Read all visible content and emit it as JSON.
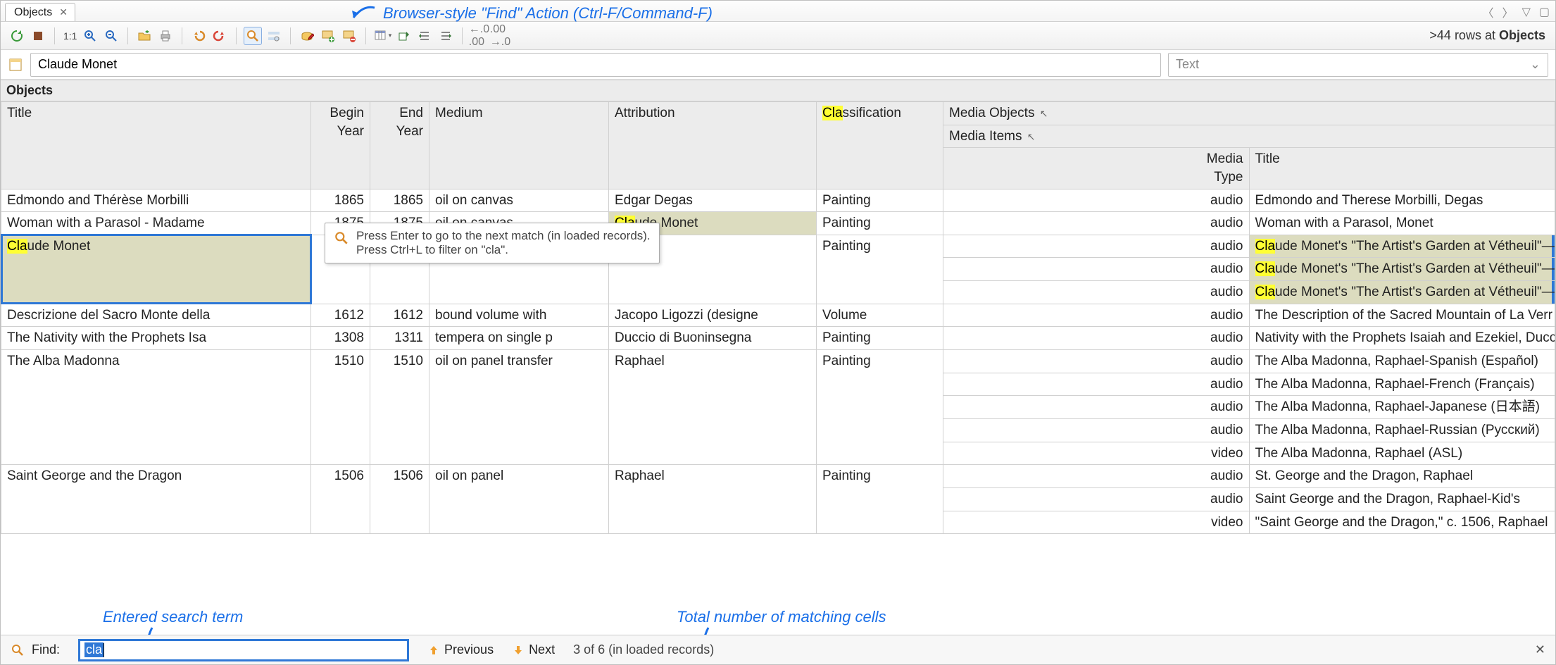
{
  "tab": {
    "title": "Objects"
  },
  "annotations": {
    "find_action": "Browser-style \"Find\" Action (Ctrl-F/Command-F)",
    "entered_term": "Entered search term",
    "total_match": "Total number of matching cells"
  },
  "toolbar": {
    "ratio": "1:1",
    "rowcount_prefix": ">44 rows at ",
    "rowcount_target": "Objects"
  },
  "filter": {
    "value": "Claude Monet",
    "type_label": "Text"
  },
  "section": {
    "title": "Objects"
  },
  "headers": {
    "title": "Title",
    "begin": "Begin Year",
    "end": "End Year",
    "medium": "Medium",
    "attribution": "Attribution",
    "classification": "Classification",
    "media_objects": "Media Objects",
    "media_items": "Media Items",
    "media_type": "Media Type",
    "mtitle": "Title"
  },
  "rows": [
    {
      "title": "Edmondo and Thérèse Morbilli",
      "begin": "1865",
      "end": "1865",
      "medium": "oil on canvas",
      "attr": "Edgar Degas",
      "class": "Painting",
      "media": [
        {
          "type": "audio",
          "title": "Edmondo and Therese Morbilli, Degas"
        }
      ]
    },
    {
      "title": "Woman with a Parasol - Madame",
      "begin": "1875",
      "end": "1875",
      "medium": "oil on canvas",
      "attr": "Claude Monet",
      "attr_hl": "Cla",
      "class": "Painting",
      "media": [
        {
          "type": "audio",
          "title": "Woman with a Parasol, Monet"
        }
      ]
    },
    {
      "title": "Claude Monet",
      "title_hl": "Cla",
      "begin": "",
      "end": "",
      "medium": "",
      "attr": "",
      "class": "Painting",
      "current": true,
      "media": [
        {
          "type": "audio",
          "title": "Claude Monet's \"The Artist's Garden at Vétheuil\"—",
          "hl": "Cla"
        },
        {
          "type": "audio",
          "title": "Claude Monet's \"The Artist's Garden at Vétheuil\"—",
          "hl": "Cla"
        },
        {
          "type": "audio",
          "title": "Claude Monet's \"The Artist's Garden at Vétheuil\"—",
          "hl": "Cla"
        }
      ]
    },
    {
      "title": "Descrizione del Sacro Monte della",
      "begin": "1612",
      "end": "1612",
      "medium": "bound volume with",
      "attr": "Jacopo Ligozzi (designe",
      "class": "Volume",
      "media": [
        {
          "type": "audio",
          "title": "The Description of the Sacred Mountain of La Verr"
        }
      ]
    },
    {
      "title": "The Nativity with the Prophets Isa",
      "begin": "1308",
      "end": "1311",
      "medium": "tempera on single p",
      "attr": "Duccio di Buoninsegna",
      "class": "Painting",
      "media": [
        {
          "type": "audio",
          "title": "Nativity with the Prophets Isaiah and Ezekiel, Ducc"
        }
      ]
    },
    {
      "title": "The Alba Madonna",
      "begin": "1510",
      "end": "1510",
      "medium": "oil on panel transfer",
      "attr": "Raphael",
      "class": "Painting",
      "media": [
        {
          "type": "audio",
          "title": "The Alba Madonna, Raphael-Spanish (Español)"
        },
        {
          "type": "audio",
          "title": "The Alba Madonna, Raphael-French (Français)"
        },
        {
          "type": "audio",
          "title": "The Alba Madonna, Raphael-Japanese (日本語)"
        },
        {
          "type": "audio",
          "title": "The Alba Madonna, Raphael-Russian (Русский)"
        },
        {
          "type": "video",
          "title": "The Alba Madonna, Raphael (ASL)"
        }
      ]
    },
    {
      "title": "Saint George and the Dragon",
      "begin": "1506",
      "end": "1506",
      "medium": "oil on panel",
      "attr": "Raphael",
      "class": "Painting",
      "media": [
        {
          "type": "audio",
          "title": "St. George and the Dragon, Raphael"
        },
        {
          "type": "audio",
          "title": "Saint George and the Dragon, Raphael-Kid's"
        },
        {
          "type": "video",
          "title": "\"Saint George and the Dragon,\" c. 1506, Raphael"
        }
      ]
    }
  ],
  "tooltip": {
    "line1": "Press Enter to go to the next match (in loaded records).",
    "line2": "Press Ctrl+L to filter on \"cla\"."
  },
  "statusbar": {
    "find_label": "Find:",
    "find_value": "cla",
    "prev": "Previous",
    "next": "Next",
    "matchinfo": "3 of 6 (in loaded records)"
  }
}
